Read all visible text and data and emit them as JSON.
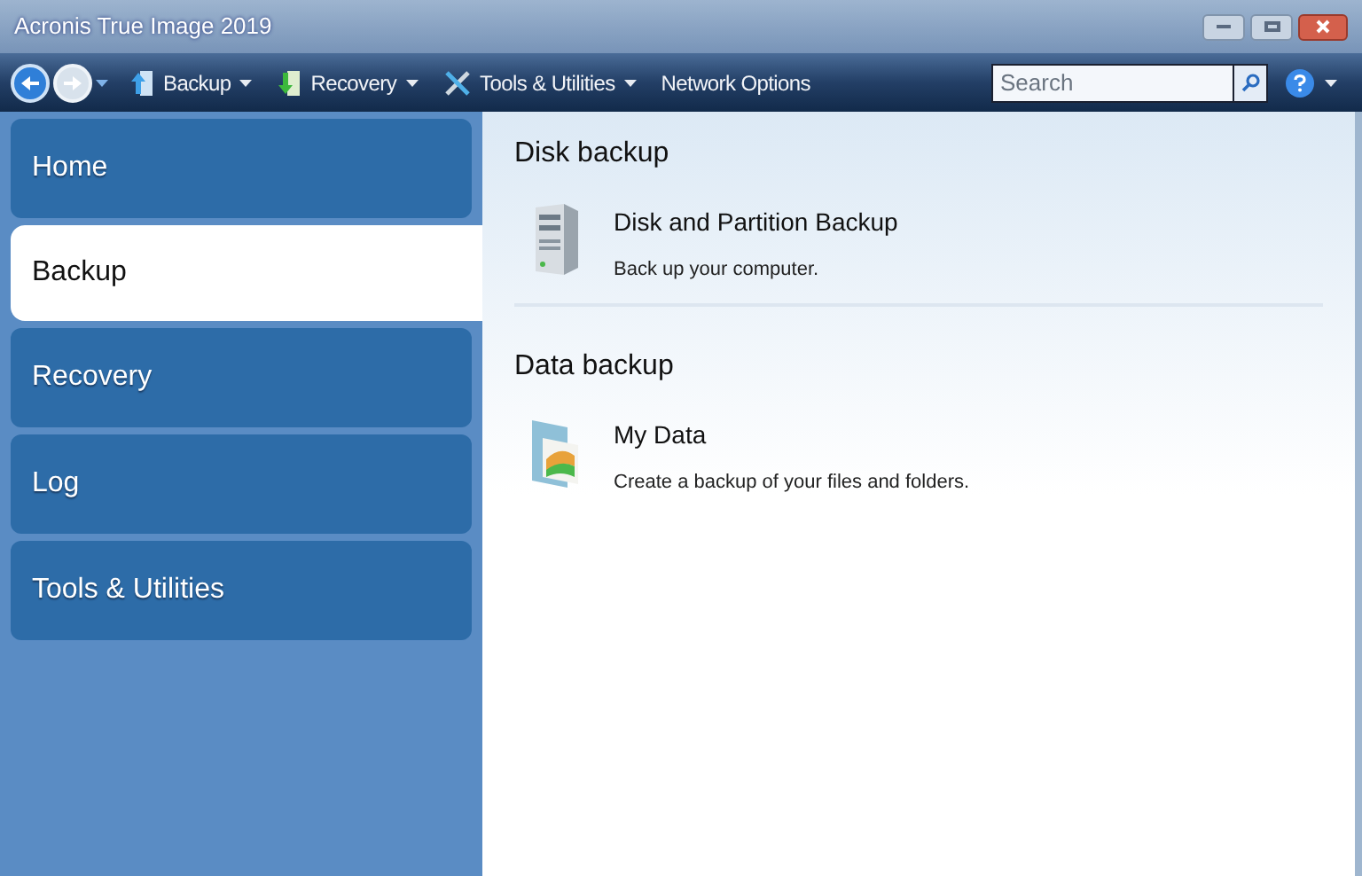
{
  "window": {
    "title": "Acronis True Image 2019"
  },
  "toolbar": {
    "menus": [
      {
        "kind": "backup",
        "label": "Backup",
        "dropdown": true
      },
      {
        "kind": "recovery",
        "label": "Recovery",
        "dropdown": true
      },
      {
        "kind": "tools",
        "label": "Tools & Utilities",
        "dropdown": true
      },
      {
        "kind": "plain",
        "label": "Network Options",
        "dropdown": false
      }
    ],
    "search": {
      "placeholder": "Search"
    }
  },
  "sidebar": {
    "items": [
      {
        "label": "Home",
        "selected": false
      },
      {
        "label": "Backup",
        "selected": true
      },
      {
        "label": "Recovery",
        "selected": false
      },
      {
        "label": "Log",
        "selected": false
      },
      {
        "label": "Tools & Utilities",
        "selected": false
      }
    ]
  },
  "sections": [
    {
      "heading": "Disk backup",
      "items": [
        {
          "kind": "disk",
          "title": "Disk and Partition Backup",
          "description": "Back up your computer."
        }
      ]
    },
    {
      "heading": "Data backup",
      "items": [
        {
          "kind": "data",
          "title": "My Data",
          "description": "Create a backup of your files and folders."
        }
      ]
    }
  ]
}
